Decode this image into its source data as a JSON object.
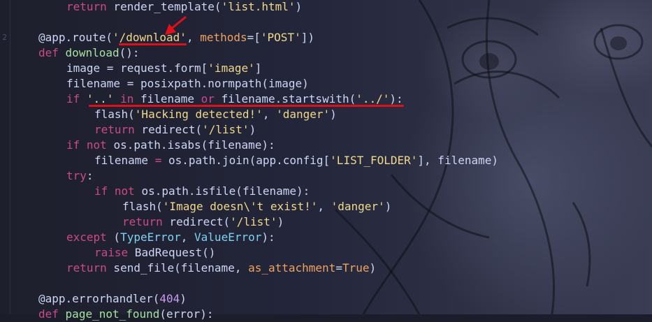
{
  "lines": [
    {
      "num": "",
      "indent": 1,
      "tokens": [
        {
          "t": "return",
          "c": "kw"
        },
        {
          "t": " render_template(",
          "c": "pl"
        },
        {
          "t": "'list.html'",
          "c": "str"
        },
        {
          "t": ")",
          "c": "pl"
        }
      ]
    },
    {
      "num": "",
      "indent": 0,
      "tokens": []
    },
    {
      "num": "2",
      "indent": 0,
      "tokens": [
        {
          "t": "@app.route(",
          "c": "pl"
        },
        {
          "t": "'/download'",
          "c": "str"
        },
        {
          "t": ", ",
          "c": "pl"
        },
        {
          "t": "methods",
          "c": "bi"
        },
        {
          "t": "=[",
          "c": "pl"
        },
        {
          "t": "'POST'",
          "c": "str"
        },
        {
          "t": "])",
          "c": "pl"
        }
      ]
    },
    {
      "num": "",
      "indent": 0,
      "tokens": [
        {
          "t": "def",
          "c": "kw"
        },
        {
          "t": " ",
          "c": "pl"
        },
        {
          "t": "download",
          "c": "fn"
        },
        {
          "t": "():",
          "c": "pl"
        }
      ]
    },
    {
      "num": "",
      "indent": 1,
      "tokens": [
        {
          "t": "image = request.form[",
          "c": "pl"
        },
        {
          "t": "'image'",
          "c": "str"
        },
        {
          "t": "]",
          "c": "pl"
        }
      ]
    },
    {
      "num": "",
      "indent": 1,
      "tokens": [
        {
          "t": "filename = posixpath.normpath(image)",
          "c": "pl"
        }
      ]
    },
    {
      "num": "",
      "indent": 1,
      "tokens": [
        {
          "t": "if",
          "c": "kw"
        },
        {
          "t": " ",
          "c": "pl"
        },
        {
          "t": "'..'",
          "c": "str"
        },
        {
          "t": " ",
          "c": "pl"
        },
        {
          "t": "in",
          "c": "kw"
        },
        {
          "t": " filename ",
          "c": "pl"
        },
        {
          "t": "or",
          "c": "kw"
        },
        {
          "t": " filename.startswith(",
          "c": "pl"
        },
        {
          "t": "'../'",
          "c": "str"
        },
        {
          "t": "):",
          "c": "pl"
        }
      ]
    },
    {
      "num": "",
      "indent": 2,
      "tokens": [
        {
          "t": "flash(",
          "c": "pl"
        },
        {
          "t": "'Hacking detected!'",
          "c": "str"
        },
        {
          "t": ", ",
          "c": "pl"
        },
        {
          "t": "'danger'",
          "c": "str"
        },
        {
          "t": ")",
          "c": "pl"
        }
      ]
    },
    {
      "num": "",
      "indent": 2,
      "tokens": [
        {
          "t": "return",
          "c": "kw"
        },
        {
          "t": " redirect(",
          "c": "pl"
        },
        {
          "t": "'/list'",
          "c": "str"
        },
        {
          "t": ")",
          "c": "pl"
        }
      ]
    },
    {
      "num": "",
      "indent": 1,
      "tokens": [
        {
          "t": "if",
          "c": "kw"
        },
        {
          "t": " ",
          "c": "pl"
        },
        {
          "t": "not",
          "c": "kw"
        },
        {
          "t": " os.path.isabs(filename):",
          "c": "pl"
        }
      ]
    },
    {
      "num": "",
      "indent": 2,
      "tokens": [
        {
          "t": "filename ",
          "c": "pl"
        },
        {
          "t": "=",
          "c": "op"
        },
        {
          "t": " os.path.join(app.config[",
          "c": "pl"
        },
        {
          "t": "'LIST_FOLDER'",
          "c": "str"
        },
        {
          "t": "], filename)",
          "c": "pl"
        }
      ]
    },
    {
      "num": "",
      "indent": 1,
      "tokens": [
        {
          "t": "try",
          "c": "kw"
        },
        {
          "t": ":",
          "c": "pl"
        }
      ]
    },
    {
      "num": "",
      "indent": 2,
      "tokens": [
        {
          "t": "if",
          "c": "kw"
        },
        {
          "t": " ",
          "c": "pl"
        },
        {
          "t": "not",
          "c": "kw"
        },
        {
          "t": " os.path.isfile(filename):",
          "c": "pl"
        }
      ]
    },
    {
      "num": "",
      "indent": 3,
      "tokens": [
        {
          "t": "flash(",
          "c": "pl"
        },
        {
          "t": "'Image doesn\\'t exist!'",
          "c": "str"
        },
        {
          "t": ", ",
          "c": "pl"
        },
        {
          "t": "'danger'",
          "c": "str"
        },
        {
          "t": ")",
          "c": "pl"
        }
      ]
    },
    {
      "num": "",
      "indent": 3,
      "tokens": [
        {
          "t": "return",
          "c": "kw"
        },
        {
          "t": " redirect(",
          "c": "pl"
        },
        {
          "t": "'/list'",
          "c": "str"
        },
        {
          "t": ")",
          "c": "pl"
        }
      ]
    },
    {
      "num": "",
      "indent": 1,
      "tokens": [
        {
          "t": "except",
          "c": "kw"
        },
        {
          "t": " (",
          "c": "pl"
        },
        {
          "t": "TypeError",
          "c": "cls"
        },
        {
          "t": ", ",
          "c": "pl"
        },
        {
          "t": "ValueError",
          "c": "cls"
        },
        {
          "t": "):",
          "c": "pl"
        }
      ]
    },
    {
      "num": "",
      "indent": 2,
      "tokens": [
        {
          "t": "raise",
          "c": "kw"
        },
        {
          "t": " BadRequest()",
          "c": "pl"
        }
      ]
    },
    {
      "num": "",
      "indent": 1,
      "tokens": [
        {
          "t": "return",
          "c": "kw"
        },
        {
          "t": " send_file(filename, ",
          "c": "pl"
        },
        {
          "t": "as_attachment",
          "c": "bi"
        },
        {
          "t": "=",
          "c": "pl"
        },
        {
          "t": "True",
          "c": "bi"
        },
        {
          "t": ")",
          "c": "pl"
        }
      ]
    },
    {
      "num": "",
      "indent": 0,
      "tokens": []
    },
    {
      "num": "",
      "indent": 0,
      "tokens": [
        {
          "t": "@app.errorhandler(",
          "c": "pl"
        },
        {
          "t": "404",
          "c": "num"
        },
        {
          "t": ")",
          "c": "pl"
        }
      ]
    },
    {
      "num": "",
      "indent": 0,
      "tokens": [
        {
          "t": "def",
          "c": "kw"
        },
        {
          "t": " ",
          "c": "pl"
        },
        {
          "t": "page_not_found",
          "c": "fn"
        },
        {
          "t": "(error):",
          "c": "pl"
        }
      ]
    }
  ],
  "colors": {
    "keyword": "#cb4a8a",
    "string": "#f0d98a",
    "function": "#a6e3a1",
    "annotation": "#e0101a"
  }
}
